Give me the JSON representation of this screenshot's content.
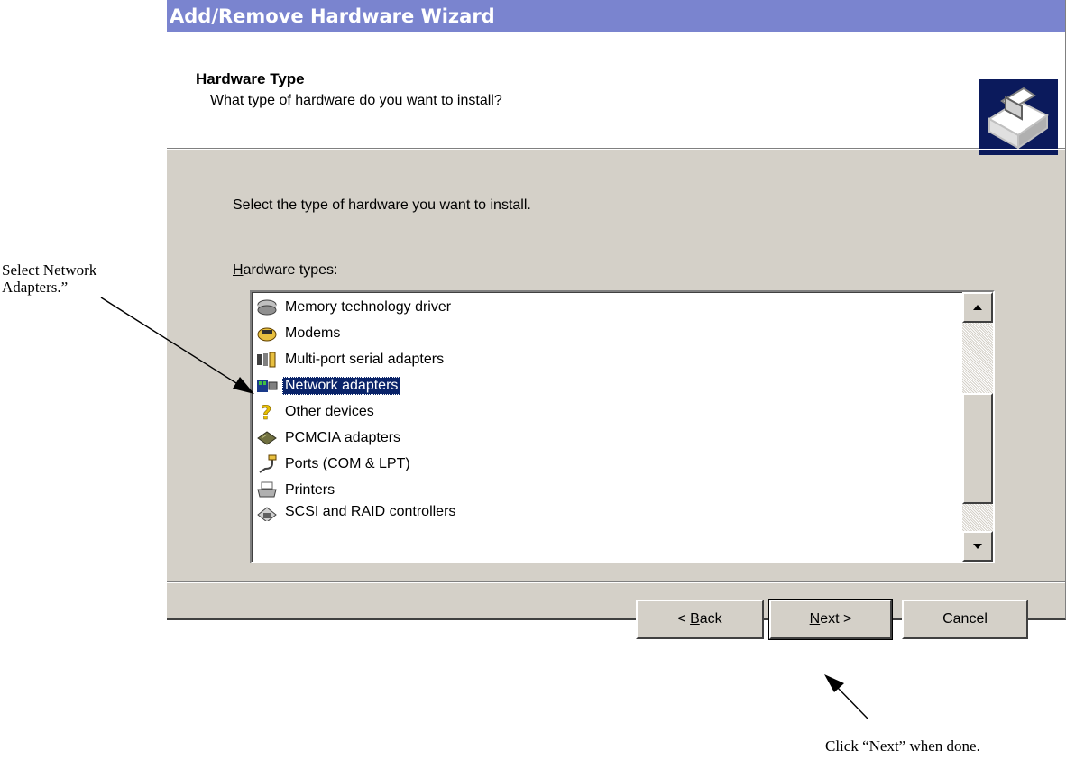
{
  "window": {
    "title": "Add/Remove Hardware Wizard"
  },
  "header": {
    "title": "Hardware Type",
    "subtitle": "What type of hardware do you want to install?",
    "icon": "hardware-install-icon"
  },
  "content": {
    "instruction": "Select the type of hardware you want to install.",
    "list_label_accel": "H",
    "list_label_rest": "ardware types:",
    "items": [
      {
        "label": "Memory technology driver",
        "icon": "memory-icon"
      },
      {
        "label": "Modems",
        "icon": "modem-icon"
      },
      {
        "label": "Multi-port serial adapters",
        "icon": "serial-adapter-icon"
      },
      {
        "label": "Network adapters",
        "icon": "network-adapter-icon",
        "selected": true
      },
      {
        "label": "Other devices",
        "icon": "question-mark-icon"
      },
      {
        "label": "PCMCIA adapters",
        "icon": "pcmcia-icon"
      },
      {
        "label": "Ports (COM & LPT)",
        "icon": "port-icon"
      },
      {
        "label": "Printers",
        "icon": "printer-icon"
      },
      {
        "label": "SCSI and RAID controllers",
        "icon": "scsi-icon"
      }
    ]
  },
  "buttons": {
    "back_prefix": "< ",
    "back_accel": "B",
    "back_rest": "ack",
    "next_accel": "N",
    "next_rest": "ext >",
    "cancel": "Cancel"
  },
  "annotations": {
    "left": "Select Network Adapters.”",
    "right": "Click “Next” when done."
  },
  "colors": {
    "titlebar": "#7a84cf",
    "dialog": "#d4d0c8",
    "selection": "#0a246a"
  }
}
